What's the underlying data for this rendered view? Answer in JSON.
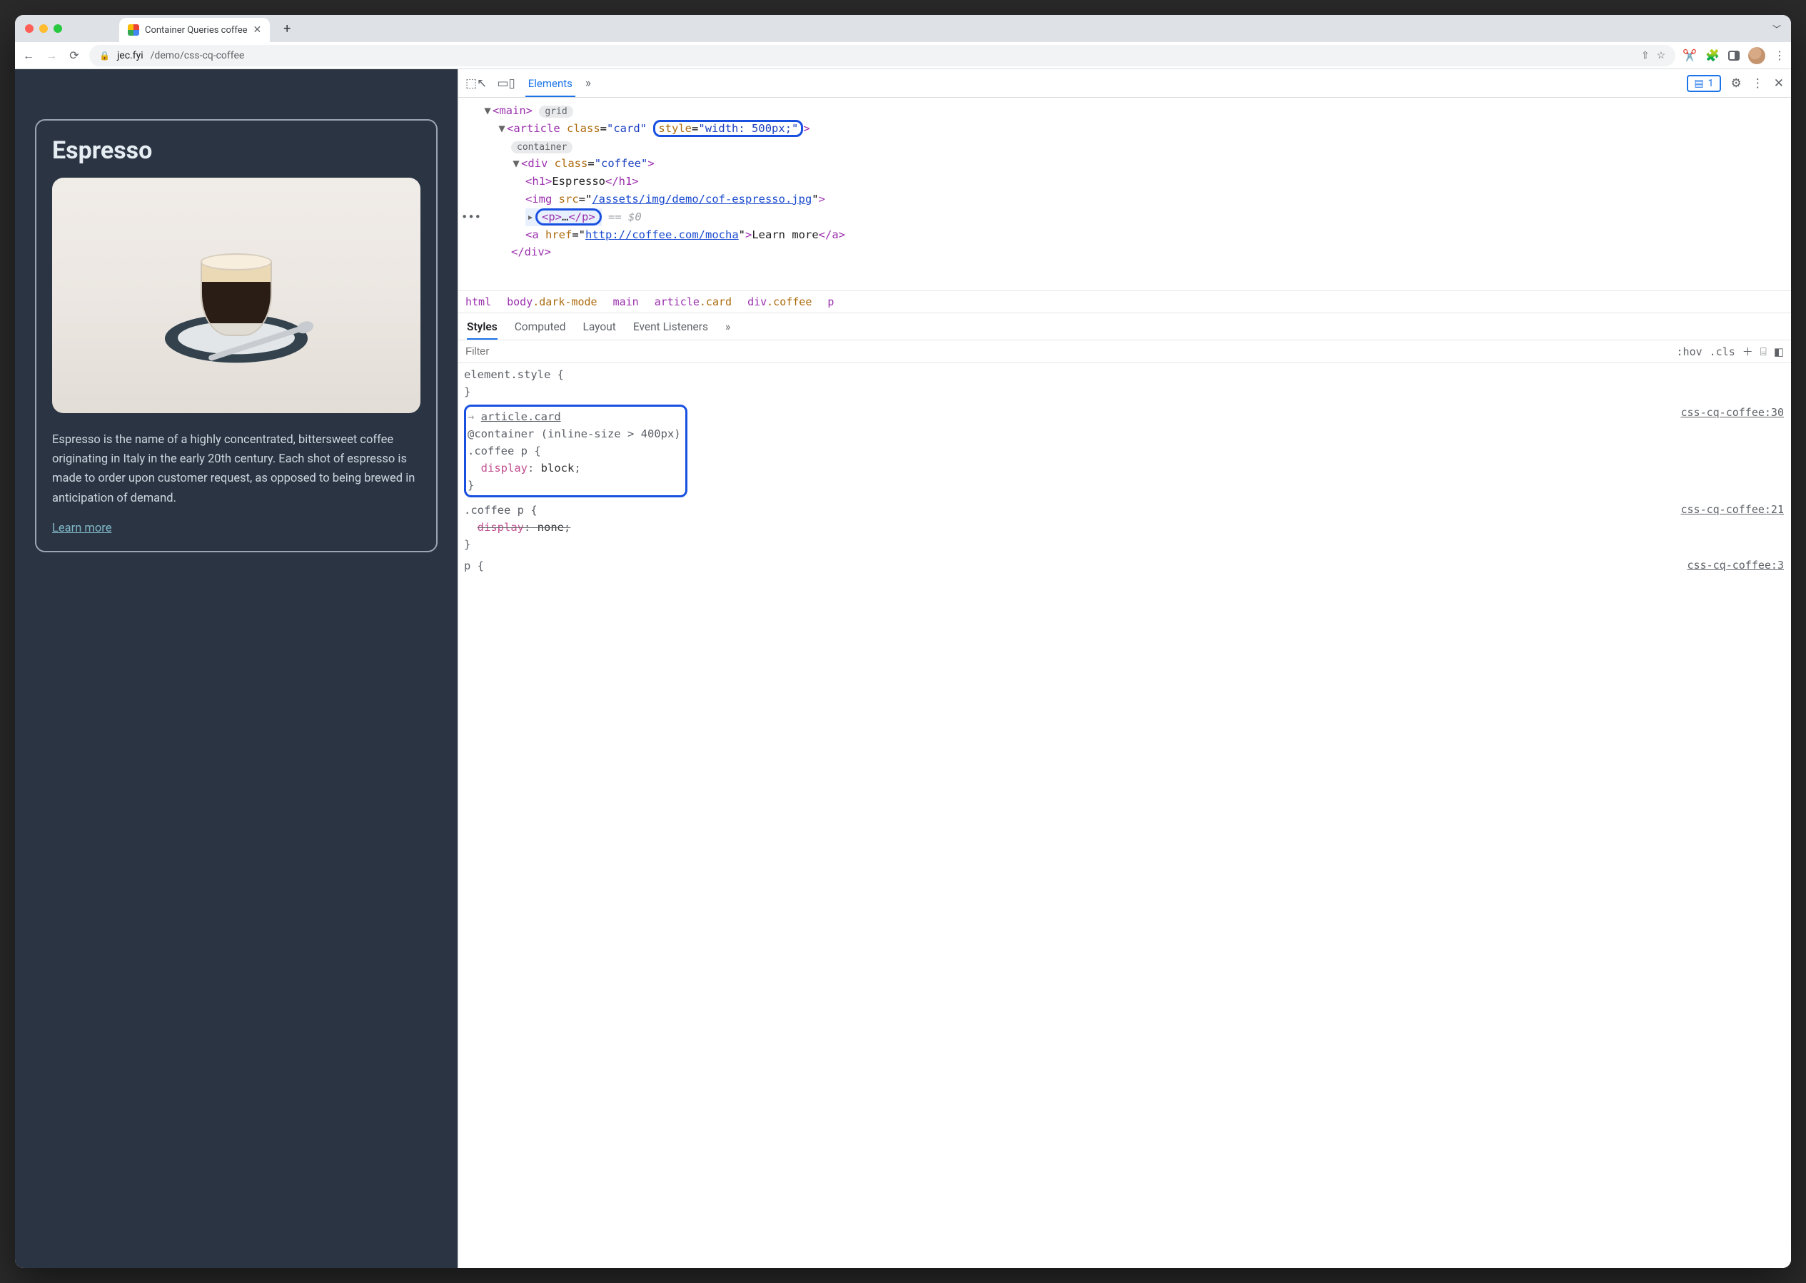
{
  "tab": {
    "title": "Container Queries coffee"
  },
  "url": {
    "host": "jec.fyi",
    "path": "/demo/css-cq-coffee"
  },
  "page": {
    "title": "Espresso",
    "description": "Espresso is the name of a highly concentrated, bittersweet coffee originating in Italy in the early 20th century. Each shot of espresso is made to order upon customer request, as opposed to being brewed in anticipation of demand.",
    "link_text": "Learn more"
  },
  "devtools": {
    "tab_active": "Elements",
    "issues_count": "1",
    "tree": {
      "main_tag": "main",
      "main_badge": "grid",
      "article_open": "<article class=\"card\" style=\"width: 500px;\">",
      "article_badge": "container",
      "div_open": "<div class=\"coffee\">",
      "h1": "Espresso",
      "img_src": "/assets/img/demo/cof-espresso.jpg",
      "p": "…",
      "p_eq": "== $0",
      "a_href": "http://coffee.com/mocha",
      "a_text": "Learn more"
    },
    "breadcrumb": [
      "html",
      "body.dark-mode",
      "main",
      "article.card",
      "div.coffee",
      "p"
    ],
    "styles_tabs": [
      "Styles",
      "Computed",
      "Layout",
      "Event Listeners"
    ],
    "filter_placeholder": "Filter",
    "filter_tools": {
      "hov": ":hov",
      "cls": ".cls"
    },
    "rules": {
      "element_style": "element.style {",
      "container_line": "@container (inline-size > 400px)",
      "container_inherit": "article.card",
      "r1_sel": ".coffee p {",
      "r1_prop": "display",
      "r1_val": "block",
      "r1_src": "css-cq-coffee:30",
      "r2_sel": ".coffee p {",
      "r2_prop": "display",
      "r2_val": "none",
      "r2_src": "css-cq-coffee:21",
      "r3_sel": "p {",
      "r3_src": "css-cq-coffee:3"
    }
  }
}
